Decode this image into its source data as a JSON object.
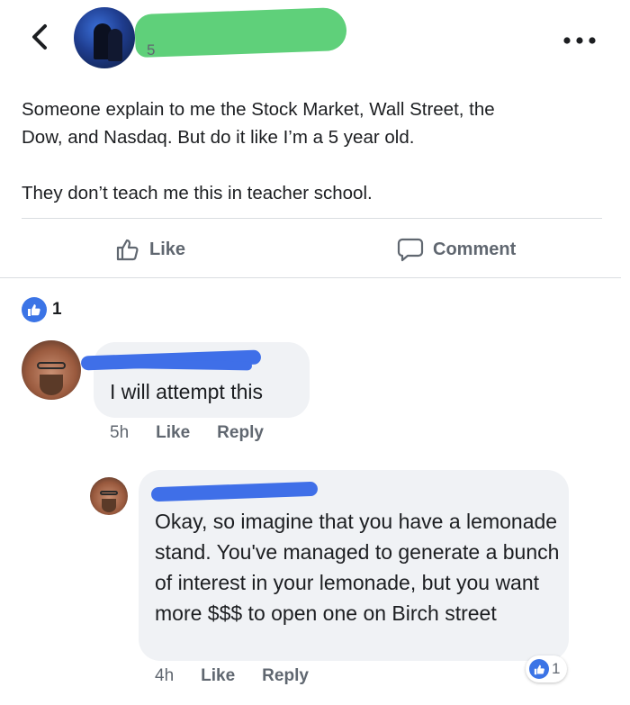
{
  "header": {
    "back_icon": "chevron-left-icon",
    "author_meta_visible": "5",
    "more_icon": "more-dots-icon"
  },
  "post": {
    "text": "Someone explain to me the Stock Market, Wall Street, the\nDow, and Nasdaq. But do it like I’m a 5 year old.\n\nThey don’t teach me this in teacher school."
  },
  "actions": {
    "like_label": "Like",
    "comment_label": "Comment"
  },
  "reactions": {
    "count": "1"
  },
  "comments": [
    {
      "text": "I will attempt this",
      "time": "5h",
      "like_label": "Like",
      "reply_label": "Reply"
    },
    {
      "text": "Okay, so imagine that you have a lemonade stand. You've managed to generate a bunch of interest in your lemonade, but you want more $$$ to open one on Birch street",
      "time": "4h",
      "like_label": "Like",
      "reply_label": "Reply",
      "reaction_count": "1"
    }
  ],
  "colors": {
    "accent_blue": "#3b74e6",
    "redaction_green": "#5fd07a",
    "redaction_blue": "#3f6fe8",
    "bubble_bg": "#f0f2f5",
    "muted_text": "#606770"
  }
}
